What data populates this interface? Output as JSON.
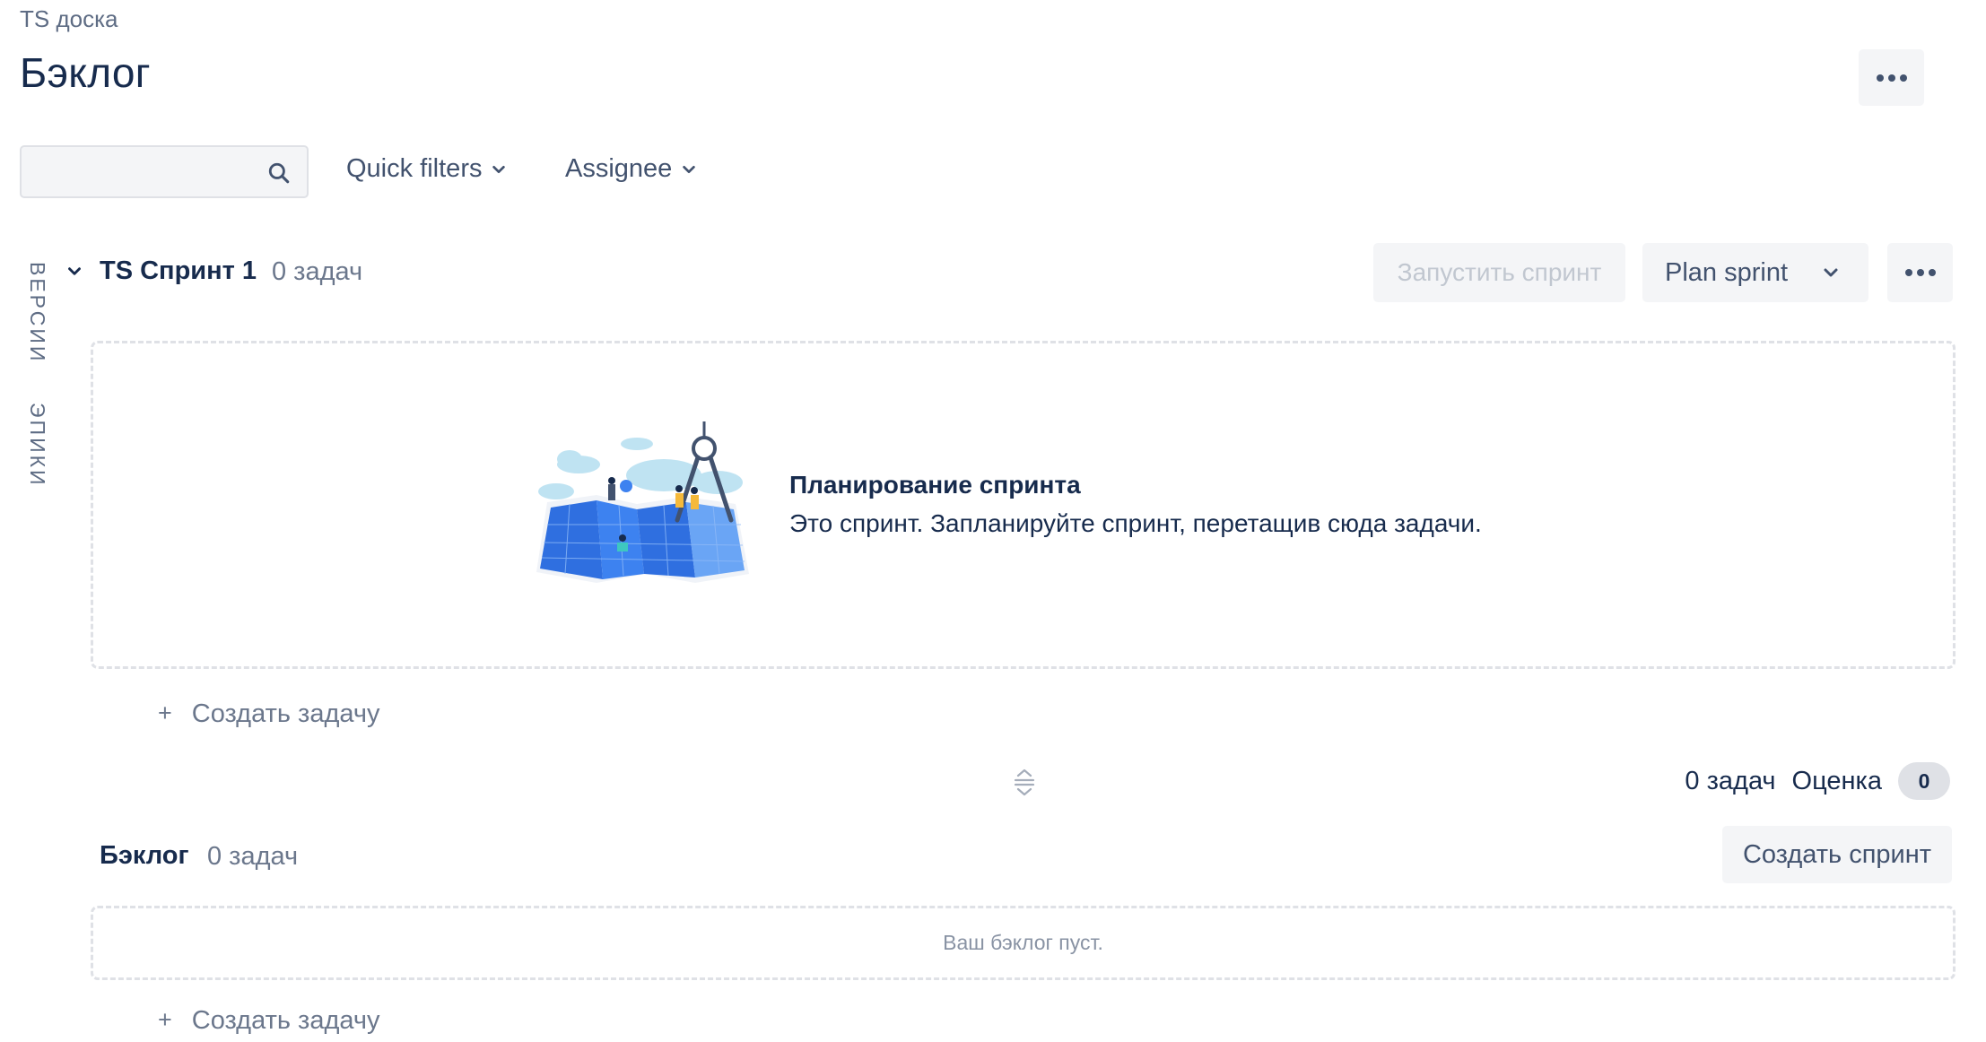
{
  "header": {
    "breadcrumb": "TS доска",
    "title": "Бэклог"
  },
  "filters": {
    "search_value": "",
    "quick_filters": "Quick filters",
    "assignee": "Assignee"
  },
  "side_tabs": {
    "versions": "ВЕРСИИ",
    "epics": "ЭПИКИ"
  },
  "sprint": {
    "name": "TS Спринт 1",
    "count": "0 задач",
    "start_label": "Запустить спринт",
    "plan_label": "Plan sprint",
    "empty_title": "Планирование спринта",
    "empty_desc": "Это спринт. Запланируйте спринт, перетащив сюда задачи.",
    "create_task_plus": "+",
    "create_task": "Создать задачу"
  },
  "stats": {
    "count": "0 задач",
    "estimate_label": "Оценка",
    "estimate_value": "0"
  },
  "backlog": {
    "name": "Бэклог",
    "count": "0 задач",
    "create_sprint": "Создать спринт",
    "empty_text": "Ваш бэклог пуст.",
    "create_task_plus": "+",
    "create_task": "Создать задачу"
  },
  "colors": {
    "text_primary": "#172b4d",
    "text_subtle": "#6b778c",
    "button_bg": "#f4f5f7",
    "dashed_border": "#dfe1e6",
    "map_blue": "#2f6fe0"
  }
}
